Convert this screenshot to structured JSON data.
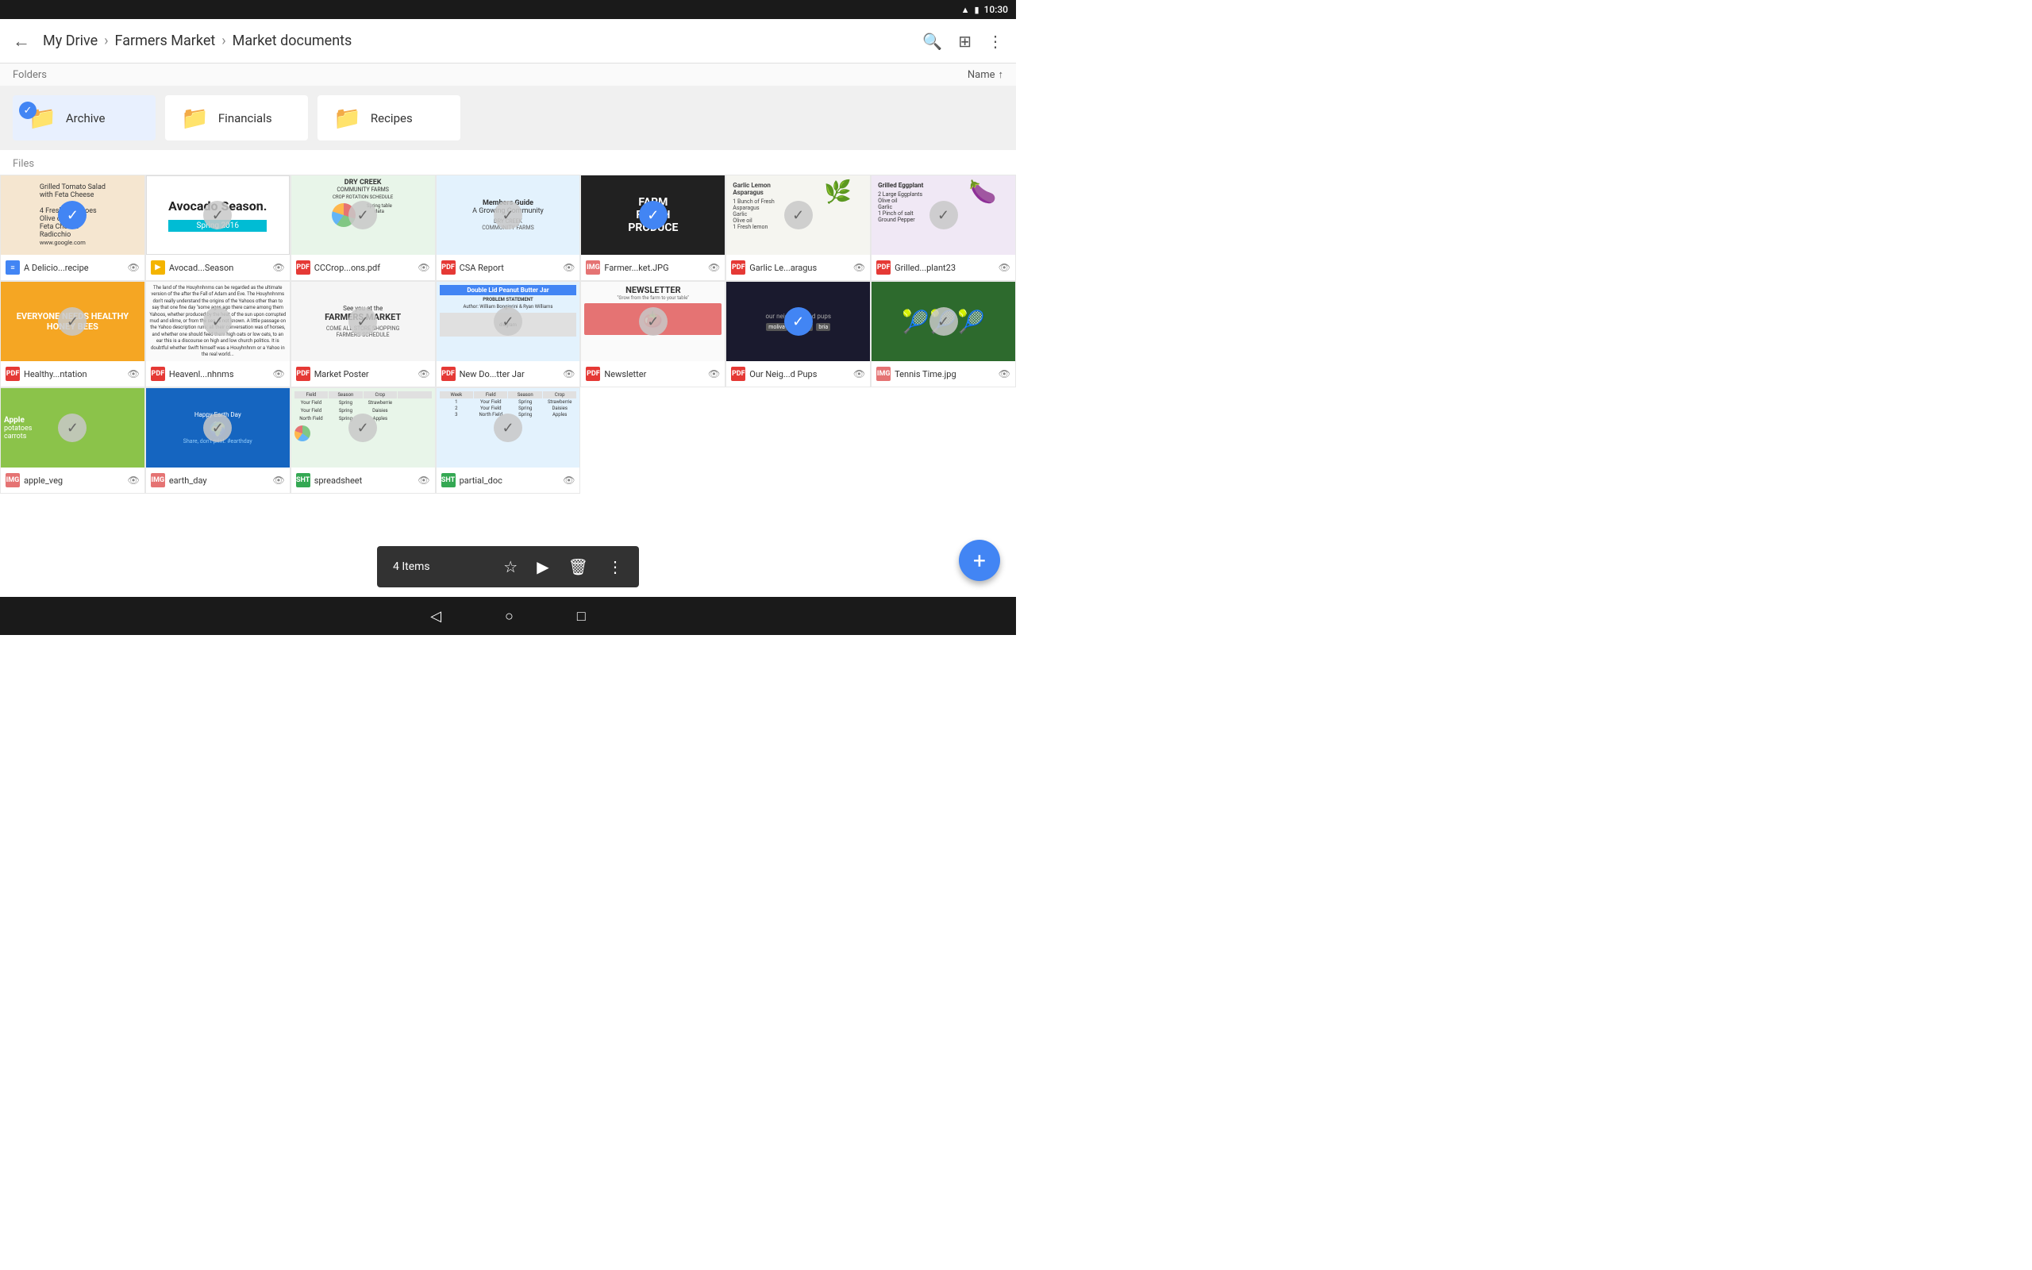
{
  "statusBar": {
    "time": "10:30",
    "icons": [
      "wifi",
      "battery"
    ]
  },
  "toolbar": {
    "backLabel": "←",
    "breadcrumb": {
      "root": "My Drive",
      "sep1": "›",
      "folder": "Farmers Market",
      "sep2": "›",
      "current": "Market documents"
    },
    "actions": {
      "search": "🔍",
      "grid": "⊞",
      "more": "⋮"
    }
  },
  "foldersSection": {
    "label": "Folders",
    "sortLabel": "Name",
    "sortIcon": "↑",
    "items": [
      {
        "id": "archive",
        "name": "Archive",
        "color": "#4285f4",
        "selected": true
      },
      {
        "id": "financials",
        "name": "Financials",
        "color": "#f4b400",
        "selected": false
      },
      {
        "id": "recipes",
        "name": "Recipes",
        "color": "#a142f4",
        "selected": false
      }
    ]
  },
  "filesSection": {
    "label": "Files",
    "items": [
      {
        "id": "delicio-recipe",
        "name": "A Delicio...recipe",
        "type": "doc",
        "typeLabel": "DOC",
        "thumbStyle": "thumb-tomato",
        "thumbText": "Grilled Tomato Salad with Feta Cheese",
        "checked": true,
        "checkActive": true
      },
      {
        "id": "avocad-season",
        "name": "Avocad...Season",
        "type": "slides",
        "typeLabel": "SLD",
        "thumbStyle": "thumb-avocado",
        "thumbText": "Avocado Season.",
        "checked": true,
        "checkActive": false
      },
      {
        "id": "cccrops-pdf",
        "name": "CCCrop...ons.pdf",
        "type": "pdf",
        "typeLabel": "PDF",
        "thumbStyle": "thumb-drycreek",
        "thumbText": "DRY CREEK",
        "checked": true,
        "checkActive": false
      },
      {
        "id": "csa-report",
        "name": "CSA Report",
        "type": "pdf",
        "typeLabel": "PDF",
        "thumbStyle": "thumb-csa",
        "thumbText": "Members Guide",
        "checked": true,
        "checkActive": false
      },
      {
        "id": "farmers-market-jpg",
        "name": "Farmer...ket.JPG",
        "type": "img",
        "typeLabel": "IMG",
        "thumbStyle": "thumb-farmfresh",
        "thumbText": "FARM FRESH PRODUCE",
        "checked": true,
        "checkActive": true
      },
      {
        "id": "garlic-asparagus",
        "name": "Garlic Le...aragus",
        "type": "pdf",
        "typeLabel": "PDF",
        "thumbStyle": "thumb-garlic",
        "thumbText": "Garlic Lemon Asparagus",
        "checked": true,
        "checkActive": false
      },
      {
        "id": "grilled-eggplant",
        "name": "Grilled...plant23",
        "type": "pdf",
        "typeLabel": "PDF",
        "thumbStyle": "thumb-eggplant",
        "thumbText": "Grilled Eggplant",
        "checked": true,
        "checkActive": false
      },
      {
        "id": "healthy-ntation",
        "name": "Healthy...ntation",
        "type": "pdf",
        "typeLabel": "PDF",
        "thumbStyle": "thumb-honeybees",
        "thumbText": "EVERYONE NEEDS HEALTHY HONEY BEES",
        "checked": true,
        "checkActive": false
      },
      {
        "id": "heavenl-nhnms",
        "name": "Heavenl...nhnms",
        "type": "pdf",
        "typeLabel": "PDF",
        "thumbStyle": "thumb-heavenl",
        "thumbText": "text doc",
        "checked": true,
        "checkActive": false
      },
      {
        "id": "market-poster",
        "name": "Market Poster",
        "type": "pdf",
        "typeLabel": "PDF",
        "thumbStyle": "thumb-market",
        "thumbText": "See you at the FARMERS MARKET",
        "checked": true,
        "checkActive": false
      },
      {
        "id": "new-do-tter-jar",
        "name": "New Do...tter Jar",
        "type": "pdf",
        "typeLabel": "PDF",
        "thumbStyle": "thumb-newdo",
        "thumbText": "Double Lid Peanut Butter Jar",
        "checked": true,
        "checkActive": false
      },
      {
        "id": "newsletter",
        "name": "Newsletter",
        "type": "pdf",
        "typeLabel": "PDF",
        "thumbStyle": "thumb-newsletter",
        "thumbText": "NEWSLETTER",
        "checked": true,
        "checkActive": false
      },
      {
        "id": "our-neig-pups",
        "name": "Our Neig...d Pups",
        "type": "pdf",
        "typeLabel": "PDF",
        "thumbStyle": "thumb-ourneig",
        "thumbText": "our neighborhood pups",
        "checked": true,
        "checkActive": true
      },
      {
        "id": "tennis-time",
        "name": "Tennis Time.jpg",
        "type": "img",
        "typeLabel": "IMG",
        "thumbStyle": "thumb-tennis",
        "thumbText": "tennis balls",
        "checked": true,
        "checkActive": false
      },
      {
        "id": "apple-veg",
        "name": "apple_veg",
        "type": "img",
        "typeLabel": "IMG",
        "thumbStyle": "thumb-apple",
        "thumbText": "apples potatoes",
        "checked": true,
        "checkActive": false
      },
      {
        "id": "earth-day",
        "name": "earth_day",
        "type": "img",
        "typeLabel": "IMG",
        "thumbStyle": "thumb-earth",
        "thumbText": "Happy Earth Day",
        "checked": true,
        "checkActive": false
      },
      {
        "id": "spreadsheet",
        "name": "spreadsheet",
        "type": "sheet",
        "typeLabel": "SHT",
        "thumbStyle": "thumb-spreadsheet",
        "thumbText": "table data",
        "checked": true,
        "checkActive": false
      },
      {
        "id": "partial-doc",
        "name": "partial_doc",
        "type": "sheet",
        "typeLabel": "SHT",
        "thumbStyle": "thumb-partial",
        "thumbText": "field data",
        "checked": true,
        "checkActive": false
      }
    ]
  },
  "bottomBar": {
    "itemsLabel": "4 Items",
    "actions": {
      "star": "☆",
      "move": "▶",
      "delete": "🗑",
      "more": "⋮"
    }
  },
  "fab": {
    "label": "+"
  },
  "navBar": {
    "back": "◁",
    "home": "○",
    "recent": "□"
  }
}
